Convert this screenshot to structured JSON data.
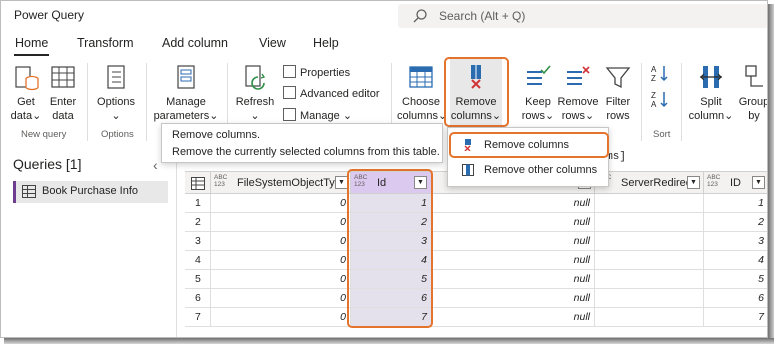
{
  "app": {
    "title": "Power Query"
  },
  "search": {
    "placeholder": "Search (Alt + Q)"
  },
  "tabs": [
    {
      "label": "Home",
      "active": true
    },
    {
      "label": "Transform",
      "active": false
    },
    {
      "label": "Add column",
      "active": false
    },
    {
      "label": "View",
      "active": false
    },
    {
      "label": "Help",
      "active": false
    }
  ],
  "ribbon": {
    "get_data": [
      "Get",
      "data"
    ],
    "enter_data": [
      "Enter",
      "data"
    ],
    "group_new_query": "New query",
    "options": [
      "Options",
      ""
    ],
    "group_options": "Options",
    "manage_parameters": [
      "Manage",
      "parameters"
    ],
    "refresh": [
      "Refresh",
      ""
    ],
    "properties": "Properties",
    "advanced_editor": "Advanced editor",
    "manage": "Manage",
    "choose_columns": [
      "Choose",
      "columns"
    ],
    "remove_columns": [
      "Remove",
      "columns"
    ],
    "keep_rows": [
      "Keep",
      "rows"
    ],
    "remove_rows": [
      "Remove",
      "rows"
    ],
    "filter_rows": [
      "Filter",
      "rows"
    ],
    "group_sort": "Sort",
    "split_column": [
      "Split",
      "column"
    ],
    "group_by": [
      "Group",
      "by"
    ]
  },
  "tooltip": {
    "title": "Remove columns.",
    "description": "Remove the currently selected columns from this table."
  },
  "menu": {
    "items": [
      "Remove columns",
      "Remove other columns"
    ]
  },
  "queries": {
    "title": "Queries [1]",
    "items": [
      "Book Purchase Info"
    ]
  },
  "formula": {
    "text": "tems]"
  },
  "table": {
    "type_badge": [
      "ABC",
      "123"
    ],
    "columns": [
      "FileSystemObjectType",
      "Id",
      "",
      "ServerRedirec...",
      "ID"
    ],
    "rows": [
      {
        "n": "1",
        "fso": "0",
        "id": "1",
        "mid": "null",
        "ID": "1"
      },
      {
        "n": "2",
        "fso": "0",
        "id": "2",
        "mid": "null",
        "ID": "2"
      },
      {
        "n": "3",
        "fso": "0",
        "id": "3",
        "mid": "null",
        "ID": "3"
      },
      {
        "n": "4",
        "fso": "0",
        "id": "4",
        "mid": "null",
        "ID": "4"
      },
      {
        "n": "5",
        "fso": "0",
        "id": "5",
        "mid": "null",
        "ID": "5"
      },
      {
        "n": "6",
        "fso": "0",
        "id": "6",
        "mid": "null",
        "ID": "6"
      },
      {
        "n": "7",
        "fso": "0",
        "id": "7",
        "mid": "null",
        "ID": "7"
      }
    ]
  },
  "colors": {
    "highlight": "#e3742d",
    "selected_column": "#e5e1ec",
    "selected_header": "#dcc9ef",
    "accent_blue": "#2b6cb0",
    "remove_red": "#d13438"
  }
}
